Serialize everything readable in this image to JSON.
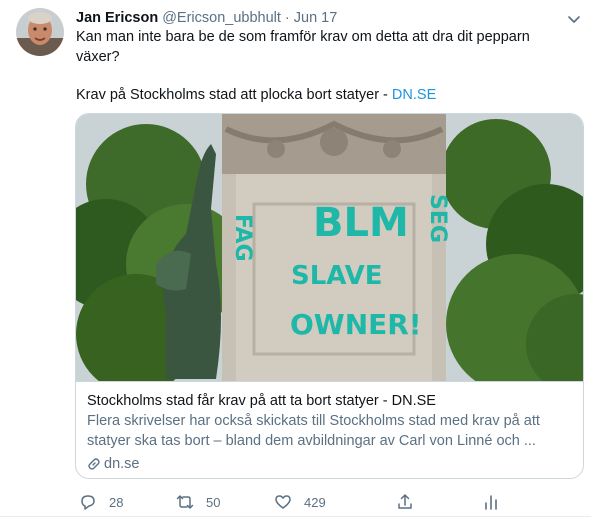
{
  "tweet": {
    "author_name": "Jan Ericson",
    "author_handle": "@Ericson_ubbhult",
    "separator": "·",
    "date": "Jun 17",
    "text_line1": "Kan man inte bara be de som framför krav om detta att dra dit pepparn växer?",
    "text_line2_prefix": "Krav på Stockholms stad att plocka bort statyer - ",
    "text_line2_link": "DN.SE",
    "link_color": "#1b95e0"
  },
  "card": {
    "image_graffiti": [
      "BLM",
      "SLAVE",
      "OWNER!",
      "FAG",
      "SEG"
    ],
    "title": "Stockholms stad får krav på att ta bort statyer - DN.SE",
    "description": "Flera skrivelser har också skickats till Stockholms stad med krav på att statyer ska tas bort – bland dem avbildningar av Carl von Linné och ...",
    "domain": "dn.se",
    "domain_icon": "link-icon"
  },
  "actions": {
    "reply_count": "28",
    "retweet_count": "50",
    "like_count": "429",
    "reply_icon": "reply-icon",
    "retweet_icon": "retweet-icon",
    "like_icon": "heart-icon",
    "share_icon": "share-icon",
    "analytics_icon": "analytics-icon"
  }
}
